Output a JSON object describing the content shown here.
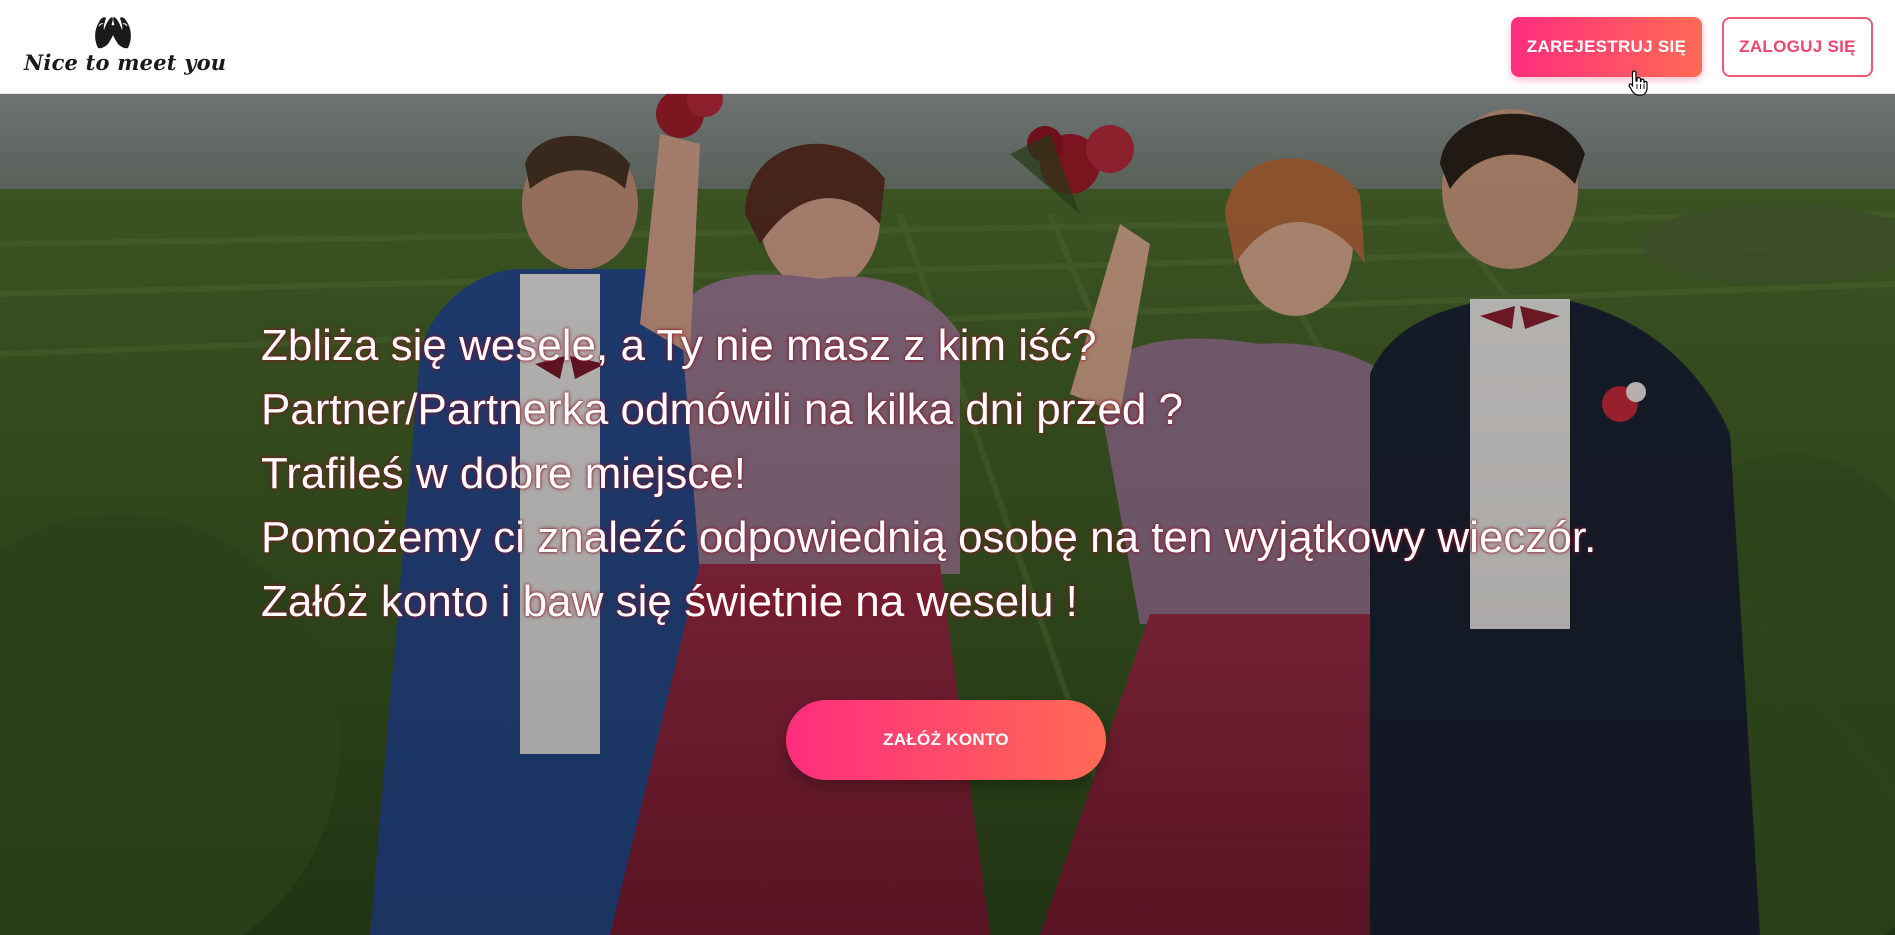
{
  "header": {
    "logo_text": "Nice to meet you",
    "register_label": "ZAREJESTRUJ SIĘ",
    "login_label": "ZALOGUJ SIĘ"
  },
  "hero": {
    "lines": [
      "Zbliża się wesele, a Ty nie masz z kim iść?",
      "Partner/Partnerka odmówili na kilka dni przed ?",
      "Trafileś w dobre miejsce!",
      "Pomożemy ci znaleźć odpowiednią osobę na ten wyjątkowy wieczór.",
      "Załóż konto i baw się świetnie na weselu !"
    ],
    "cta_label": "ZAŁÓŻ KONTO",
    "image": "wedding-party-photo"
  },
  "colors": {
    "accent_start": "#ff2d7e",
    "accent_end": "#ff6a55",
    "outline": "#f05a79"
  }
}
